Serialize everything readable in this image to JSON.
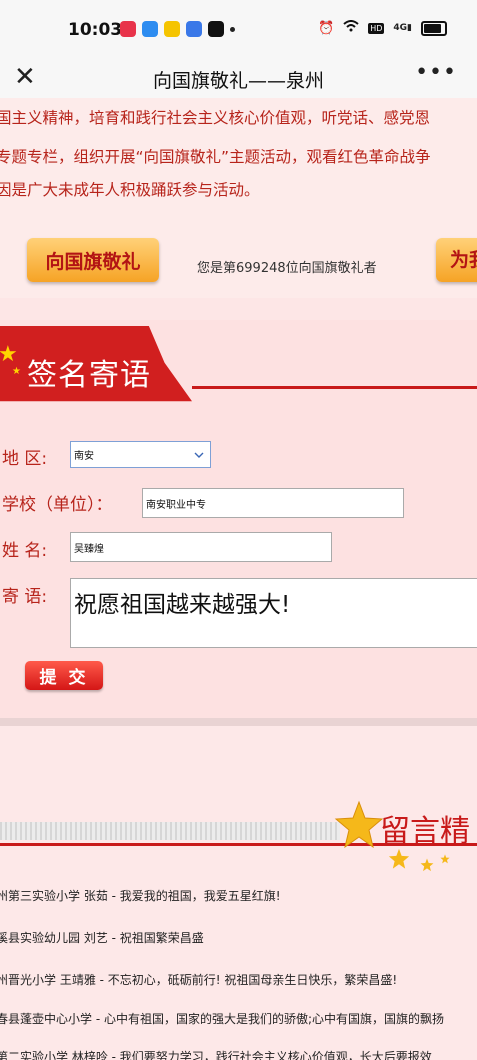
{
  "status_bar": {
    "time": "10:03",
    "network_label": "4G"
  },
  "nav": {
    "title": "向国旗敬礼——泉州",
    "more": "•••"
  },
  "intro": {
    "lines": [
      "国主义精神，培育和践行社会主义核心价值观，听党话、感党恩",
      "专题专栏，组织开展“向国旗敬礼”主题活动，观看红色革命战争",
      "因是广大未成年人积极踊跃参与活动。"
    ]
  },
  "actions": {
    "salute_button": "向国旗敬礼",
    "count_text": "您是第699248位向国旗敬礼者",
    "right_button_partial": "为我"
  },
  "sign": {
    "heading": "签名寄语",
    "labels": {
      "region": "地  区:",
      "school": "学校（单位）：",
      "name": "姓  名:",
      "message": "寄  语:"
    },
    "values": {
      "region": "南安",
      "school": "南安职业中专",
      "name": "吴臻煌",
      "message": "祝愿祖国越来越强大!"
    },
    "submit": "提 交"
  },
  "messages": {
    "heading": "留言精",
    "rows": [
      "州第三实验小学 张茹   - 我爱我的祖国，我爱五星红旗!",
      "溪县实验幼儿园 刘艺   - 祝祖国繁荣昌盛",
      "州晋光小学 王靖雅   - 不忘初心，砥砺前行! 祝祖国母亲生日快乐，繁荣昌盛!",
      "春县蓬壶中心小学   - 心中有祖国，国家的强大是我们的骄傲;心中有国旗，国旗的飘扬",
      "第二实验小学 林梓呤   - 我们要努力学习，践行社会主义核心价值观，长大后要报效"
    ]
  },
  "colors": {
    "accent_red": "#c81a1a",
    "gold": "#f6a325",
    "page_bg": "#fde6e6"
  }
}
